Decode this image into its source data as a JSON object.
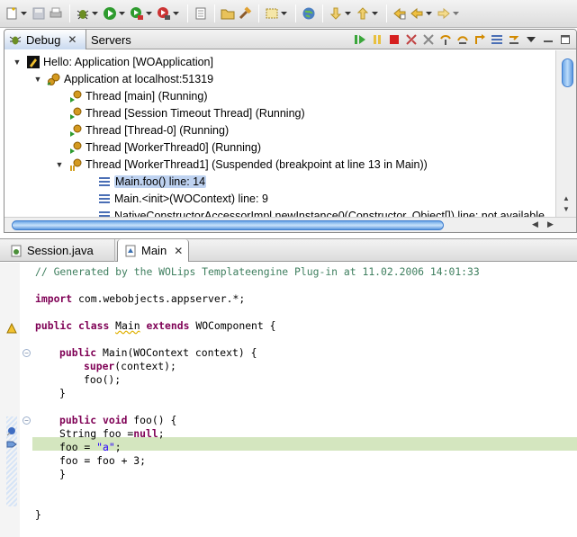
{
  "toolbar": {
    "items": [
      "new-icon",
      "save-icon",
      "print-icon",
      "debug-icon",
      "run-icon",
      "run-ext-icon",
      "ext-tools-icon",
      "page-icon",
      "open-type-icon",
      "hammer-icon",
      "search-icon",
      "globe-icon",
      "next-annotation-icon",
      "prev-annotation-icon",
      "last-edit-icon",
      "back-icon",
      "forward-icon"
    ]
  },
  "debug_view": {
    "tabs": [
      {
        "label": "Debug",
        "active": true
      },
      {
        "label": "Servers",
        "active": false
      }
    ],
    "tree": [
      {
        "label": "Hello: Application [WOApplication]",
        "level": 0,
        "type": "launch"
      },
      {
        "label": "Application at localhost:51319",
        "level": 1,
        "type": "target"
      },
      {
        "label": "Thread [main] (Running)",
        "level": 2,
        "type": "thread-running"
      },
      {
        "label": "Thread [Session Timeout Thread] (Running)",
        "level": 2,
        "type": "thread-running"
      },
      {
        "label": "Thread [Thread-0] (Running)",
        "level": 2,
        "type": "thread-running"
      },
      {
        "label": "Thread [WorkerThread0] (Running)",
        "level": 2,
        "type": "thread-running"
      },
      {
        "label": "Thread [WorkerThread1] (Suspended (breakpoint at line 13 in Main))",
        "level": 2,
        "type": "thread-suspended"
      },
      {
        "label": "Main.foo() line: 14",
        "level": 3,
        "type": "frame",
        "selected": true
      },
      {
        "label": "Main.<init>(WOContext) line: 9",
        "level": 3,
        "type": "frame"
      },
      {
        "label": "NativeConstructorAccessorImpl.newInstance0(Constructor, Object[]) line: not available",
        "level": 3,
        "type": "frame"
      }
    ]
  },
  "editor": {
    "tabs": [
      {
        "label": "Session.java",
        "active": false
      },
      {
        "label": "Main",
        "active": true
      }
    ],
    "code": {
      "l1": "// Generated by the WOLips Templateengine Plug-in at 11.02.2006 14:01:33",
      "l3_kw": "import",
      "l3_rest": " com.webobjects.appserver.*;",
      "l5_kw1": "public",
      "l5_kw2": "class",
      "l5_name": "Main",
      "l5_kw3": "extends",
      "l5_rest": " WOComponent {",
      "l7_kw": "public",
      "l7_rest": " Main(WOContext context) {",
      "l8_kw": "super",
      "l8_rest": "(context);",
      "l9": "foo();",
      "l10": "}",
      "l12_kw1": "public",
      "l12_kw2": "void",
      "l12_rest": " foo() {",
      "l13_a": "String foo =",
      "l13_kw": "null",
      "l13_b": ";",
      "l14_a": "foo = ",
      "l14_str": "\"a\"",
      "l14_b": ";",
      "l15": "foo = foo + 3;",
      "l16": "}",
      "l19": "}"
    }
  }
}
